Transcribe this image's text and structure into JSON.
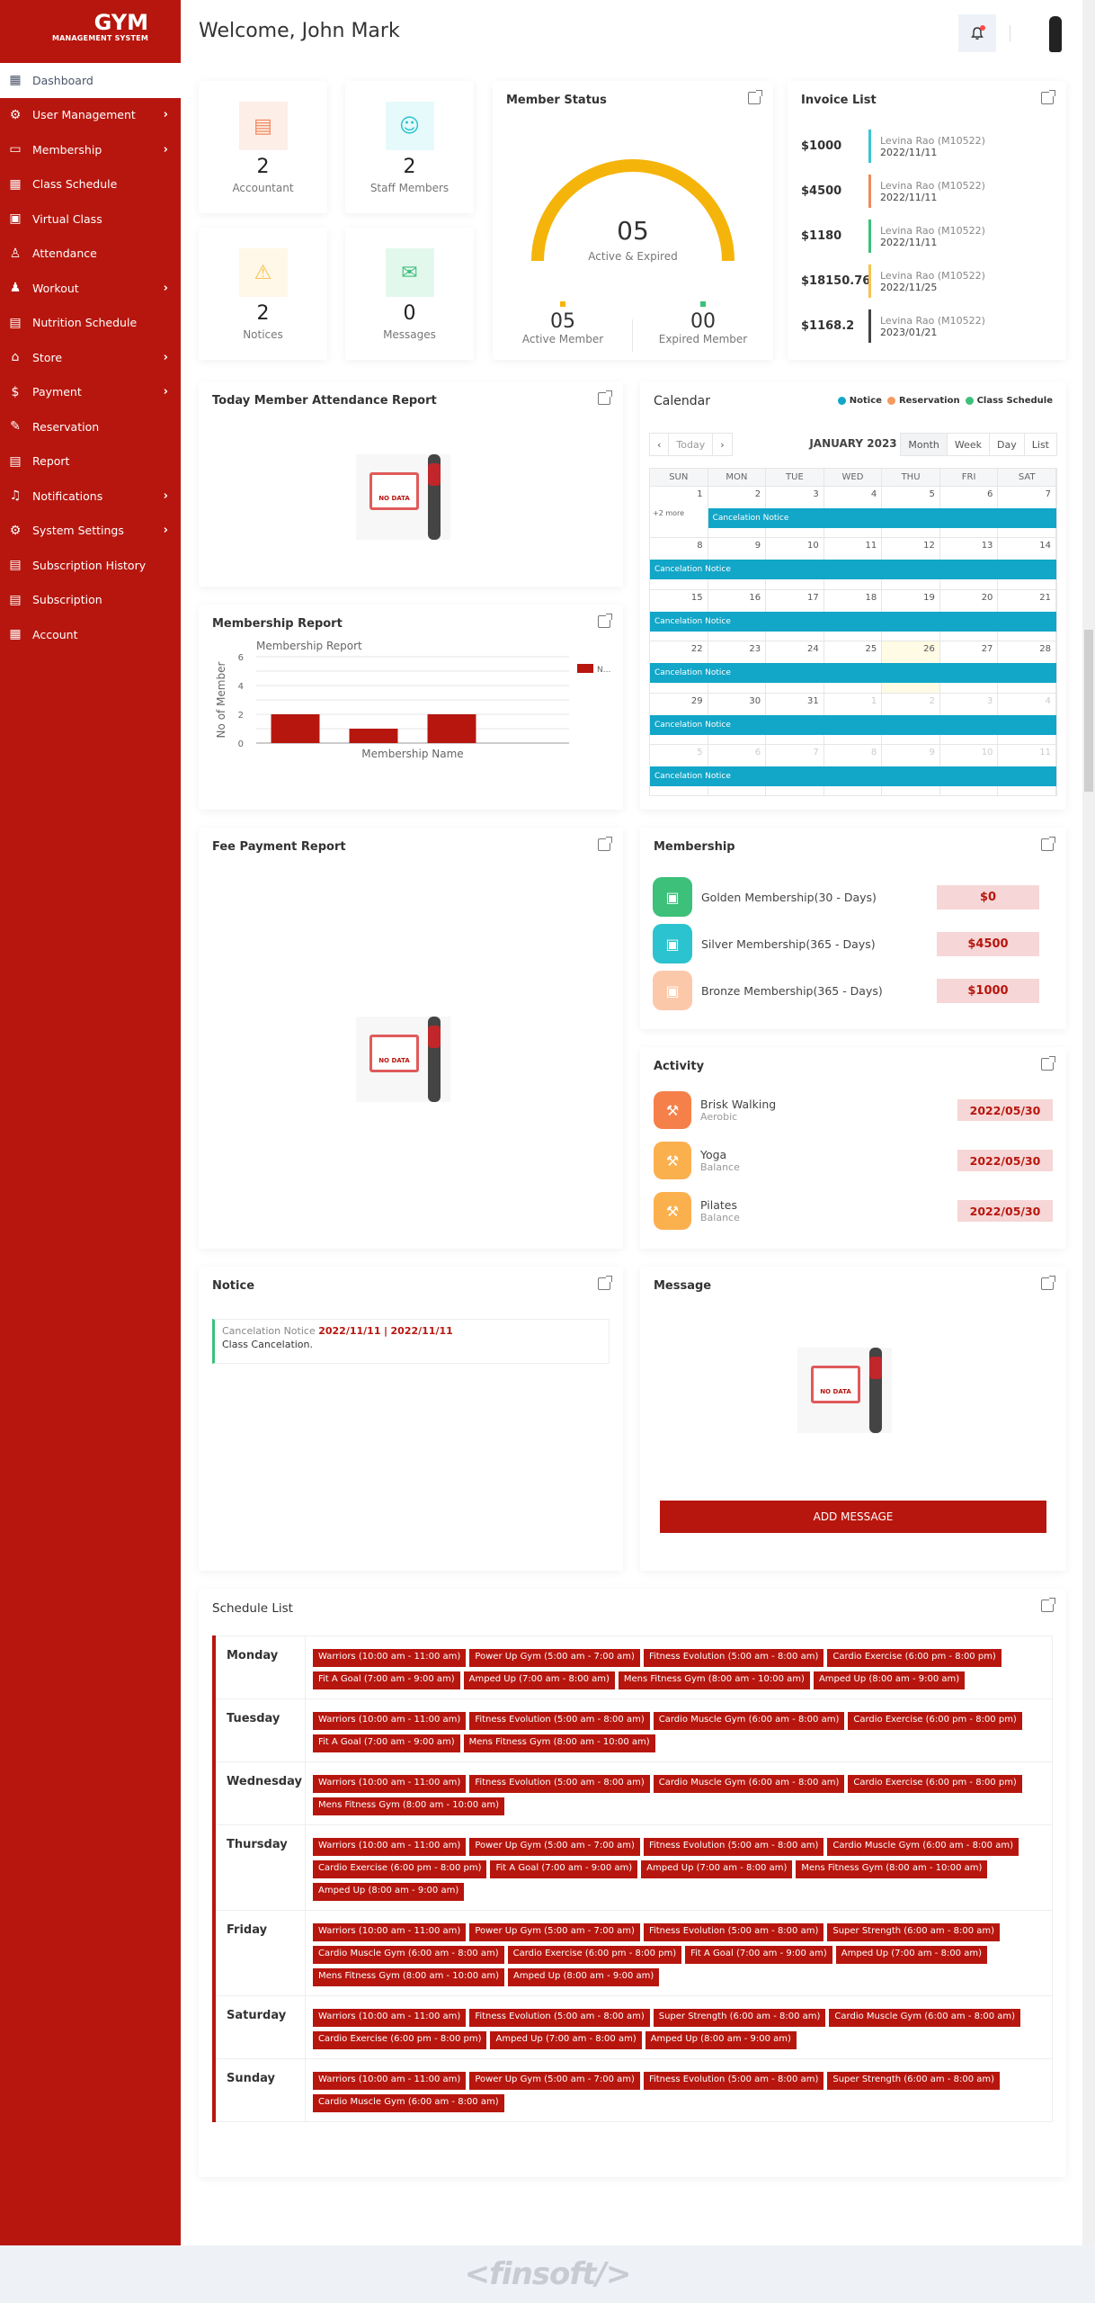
{
  "app": {
    "logo_title": "GYM",
    "logo_subtitle": "MANAGEMENT SYSTEM"
  },
  "header": {
    "welcome": "Welcome, John Mark",
    "bell_icon": "bell-icon",
    "avatar": "user-avatar"
  },
  "sidebar": {
    "items": [
      {
        "label": "Dashboard",
        "icon": "grid-icon",
        "active": true,
        "has_submenu": false
      },
      {
        "label": "User Management",
        "icon": "users-gear-icon",
        "has_submenu": true
      },
      {
        "label": "Membership",
        "icon": "id-card-icon",
        "has_submenu": true
      },
      {
        "label": "Class Schedule",
        "icon": "calendar-clock-icon",
        "has_submenu": false
      },
      {
        "label": "Virtual Class",
        "icon": "monitor-class-icon",
        "has_submenu": false
      },
      {
        "label": "Attendance",
        "icon": "user-check-icon",
        "has_submenu": false
      },
      {
        "label": "Workout",
        "icon": "workout-icon",
        "has_submenu": true
      },
      {
        "label": "Nutrition Schedule",
        "icon": "nutrition-icon",
        "has_submenu": false
      },
      {
        "label": "Store",
        "icon": "store-icon",
        "has_submenu": true
      },
      {
        "label": "Payment",
        "icon": "payment-icon",
        "has_submenu": true
      },
      {
        "label": "Reservation",
        "icon": "reservation-icon",
        "has_submenu": false
      },
      {
        "label": "Report",
        "icon": "report-icon",
        "has_submenu": false
      },
      {
        "label": "Notifications",
        "icon": "bell-icon",
        "has_submenu": true
      },
      {
        "label": "System Settings",
        "icon": "gear-icon",
        "has_submenu": true
      },
      {
        "label": "Subscription History",
        "icon": "subscription-history-icon",
        "has_submenu": false
      },
      {
        "label": "Subscription",
        "icon": "subscription-icon",
        "has_submenu": false
      },
      {
        "label": "Account",
        "icon": "account-icon",
        "has_submenu": false
      }
    ]
  },
  "stats": [
    {
      "value": "2",
      "label": "Accountant",
      "icon": "accountant-icon",
      "bg": "#fdeee8",
      "color": "#f08a5d"
    },
    {
      "value": "2",
      "label": "Staff Members",
      "icon": "staff-icon",
      "bg": "#e6fafb",
      "color": "#2bc3cf"
    },
    {
      "value": "2",
      "label": "Notices",
      "icon": "warning-icon",
      "bg": "#fff7e8",
      "color": "#f5c24c"
    },
    {
      "value": "0",
      "label": "Messages",
      "icon": "chat-icon",
      "bg": "#e3f8ed",
      "color": "#3cc07a"
    }
  ],
  "member_status": {
    "title": "Member Status",
    "total": "05",
    "total_label": "Active & Expired",
    "active": "05",
    "active_label": "Active Member",
    "expired": "00",
    "expired_label": "Expired Member",
    "active_color": "#f5b40a",
    "expired_color": "#3cc07a",
    "active_fraction": 1.0
  },
  "invoice_list": {
    "title": "Invoice List",
    "items": [
      {
        "amount": "$1000",
        "name": "Levina Rao (M10522)",
        "date": "2022/11/11",
        "color": "#3cc4d4"
      },
      {
        "amount": "$4500",
        "name": "Levina Rao (M10522)",
        "date": "2022/11/11",
        "color": "#f08a5d"
      },
      {
        "amount": "$1180",
        "name": "Levina Rao (M10522)",
        "date": "2022/11/11",
        "color": "#3cc07a"
      },
      {
        "amount": "$18150.76",
        "name": "Levina Rao (M10522)",
        "date": "2022/11/25",
        "color": "#f5c24c"
      },
      {
        "amount": "$1168.2",
        "name": "Levina Rao (M10522)",
        "date": "2023/01/21",
        "color": "#444444"
      }
    ]
  },
  "attendance_report": {
    "title": "Today Member Attendance Report",
    "empty": "NO DATA"
  },
  "calendar": {
    "title": "Calendar",
    "legend": [
      {
        "label": "Notice",
        "color": "#12a6c8"
      },
      {
        "label": "Reservation",
        "color": "#f59a5d"
      },
      {
        "label": "Class Schedule",
        "color": "#3cc07a"
      }
    ],
    "today_label": "Today",
    "month_label": "JANUARY 2023",
    "views": [
      "Month",
      "Week",
      "Day",
      "List"
    ],
    "active_view": "Month",
    "weekdays": [
      "SUN",
      "MON",
      "TUE",
      "WED",
      "THU",
      "FRI",
      "SAT"
    ],
    "weeks": [
      {
        "days": [
          "1",
          "2",
          "3",
          "4",
          "5",
          "6",
          "7"
        ],
        "event": "Cancelation Notice",
        "more": "+2 more",
        "event_start_col": 1
      },
      {
        "days": [
          "8",
          "9",
          "10",
          "11",
          "12",
          "13",
          "14"
        ],
        "event": "Cancelation Notice",
        "event_start_col": 0
      },
      {
        "days": [
          "15",
          "16",
          "17",
          "18",
          "19",
          "20",
          "21"
        ],
        "event": "Cancelation Notice",
        "event_start_col": 0
      },
      {
        "days": [
          "22",
          "23",
          "24",
          "25",
          "26",
          "27",
          "28"
        ],
        "event": "Cancelation Notice",
        "event_start_col": 0,
        "today_col": 4
      },
      {
        "days": [
          "29",
          "30",
          "31",
          "1",
          "2",
          "3",
          "4"
        ],
        "event": "Cancelation Notice",
        "event_start_col": 0,
        "other_from": 3
      },
      {
        "days": [
          "5",
          "6",
          "7",
          "8",
          "9",
          "10",
          "11"
        ],
        "event": "Cancelation Notice",
        "event_start_col": 0,
        "other_from": 0
      }
    ]
  },
  "membership_report": {
    "title": "Membership Report"
  },
  "chart_data": {
    "type": "bar",
    "title": "Membership Report",
    "xlabel": "Membership Name",
    "ylabel": "No of Member",
    "categories": [
      "",
      "",
      "",
      ""
    ],
    "values": [
      2,
      1,
      2,
      0
    ],
    "ylim": [
      0,
      6
    ],
    "yticks": [
      0,
      2,
      4,
      6
    ],
    "legend": [
      "N..."
    ],
    "legend_position": "top-right",
    "color": "#b7160e",
    "grid": true
  },
  "fee_payment": {
    "title": "Fee Payment Report",
    "empty": "NO DATA"
  },
  "membership": {
    "title": "Membership",
    "items": [
      {
        "name": "Golden Membership(30 - Days)",
        "price": "$0",
        "color": "#3cc07a"
      },
      {
        "name": "Silver Membership(365 - Days)",
        "price": "$4500",
        "color": "#2bc3cf"
      },
      {
        "name": "Bronze Membership(365 - Days)",
        "price": "$1000",
        "color": "#fcc8aa"
      }
    ]
  },
  "activity": {
    "title": "Activity",
    "items": [
      {
        "name": "Brisk Walking",
        "type": "Aerobic",
        "date": "2022/05/30",
        "color": "#f5804a"
      },
      {
        "name": "Yoga",
        "type": "Balance",
        "date": "2022/05/30",
        "color": "#fbb04e"
      },
      {
        "name": "Pilates",
        "type": "Balance",
        "date": "2022/05/30",
        "color": "#fbb04e"
      }
    ]
  },
  "notice": {
    "title": "Notice",
    "items": [
      {
        "title": "Cancelation Notice",
        "start": "2022/11/11",
        "sep": "|",
        "end": "2022/11/11",
        "desc": "Class Cancelation."
      }
    ]
  },
  "message": {
    "title": "Message",
    "empty": "NO DATA",
    "add_button": "ADD MESSAGE"
  },
  "schedule": {
    "title": "Schedule List",
    "days": [
      {
        "day": "Monday",
        "slots": [
          "Warriors (10:00 am - 11:00 am)",
          "Power Up Gym (5:00 am - 7:00 am)",
          "Fitness Evolution (5:00 am - 8:00 am)",
          "Cardio Exercise (6:00 pm - 8:00 pm)",
          "Fit A Goal (7:00 am - 9:00 am)",
          "Amped Up (7:00 am - 8:00 am)",
          "Mens Fitness Gym (8:00 am - 10:00 am)",
          "Amped Up (8:00 am - 9:00 am)"
        ]
      },
      {
        "day": "Tuesday",
        "slots": [
          "Warriors (10:00 am - 11:00 am)",
          "Fitness Evolution (5:00 am - 8:00 am)",
          "Cardio Muscle Gym (6:00 am - 8:00 am)",
          "Cardio Exercise (6:00 pm - 8:00 pm)",
          "Fit A Goal (7:00 am - 9:00 am)",
          "Mens Fitness Gym (8:00 am - 10:00 am)"
        ]
      },
      {
        "day": "Wednesday",
        "slots": [
          "Warriors (10:00 am - 11:00 am)",
          "Fitness Evolution (5:00 am - 8:00 am)",
          "Cardio Muscle Gym (6:00 am - 8:00 am)",
          "Cardio Exercise (6:00 pm - 8:00 pm)",
          "Mens Fitness Gym (8:00 am - 10:00 am)"
        ]
      },
      {
        "day": "Thursday",
        "slots": [
          "Warriors (10:00 am - 11:00 am)",
          "Power Up Gym (5:00 am - 7:00 am)",
          "Fitness Evolution (5:00 am - 8:00 am)",
          "Cardio Muscle Gym (6:00 am - 8:00 am)",
          "Cardio Exercise (6:00 pm - 8:00 pm)",
          "Fit A Goal (7:00 am - 9:00 am)",
          "Amped Up (7:00 am - 8:00 am)",
          "Mens Fitness Gym (8:00 am - 10:00 am)",
          "Amped Up (8:00 am - 9:00 am)"
        ]
      },
      {
        "day": "Friday",
        "slots": [
          "Warriors (10:00 am - 11:00 am)",
          "Power Up Gym (5:00 am - 7:00 am)",
          "Fitness Evolution (5:00 am - 8:00 am)",
          "Super Strength (6:00 am - 8:00 am)",
          "Cardio Muscle Gym (6:00 am - 8:00 am)",
          "Cardio Exercise (6:00 pm - 8:00 pm)",
          "Fit A Goal (7:00 am - 9:00 am)",
          "Amped Up (7:00 am - 8:00 am)",
          "Mens Fitness Gym (8:00 am - 10:00 am)",
          "Amped Up (8:00 am - 9:00 am)"
        ]
      },
      {
        "day": "Saturday",
        "slots": [
          "Warriors (10:00 am - 11:00 am)",
          "Fitness Evolution (5:00 am - 8:00 am)",
          "Super Strength (6:00 am - 8:00 am)",
          "Cardio Muscle Gym (6:00 am - 8:00 am)",
          "Cardio Exercise (6:00 pm - 8:00 pm)",
          "Amped Up (7:00 am - 8:00 am)",
          "Amped Up (8:00 am - 9:00 am)"
        ]
      },
      {
        "day": "Sunday",
        "slots": [
          "Warriors (10:00 am - 11:00 am)",
          "Power Up Gym (5:00 am - 7:00 am)",
          "Fitness Evolution (5:00 am - 8:00 am)",
          "Super Strength (6:00 am - 8:00 am)",
          "Cardio Muscle Gym (6:00 am - 8:00 am)"
        ]
      }
    ]
  },
  "footer": {
    "logo": "<finsoft/>"
  }
}
